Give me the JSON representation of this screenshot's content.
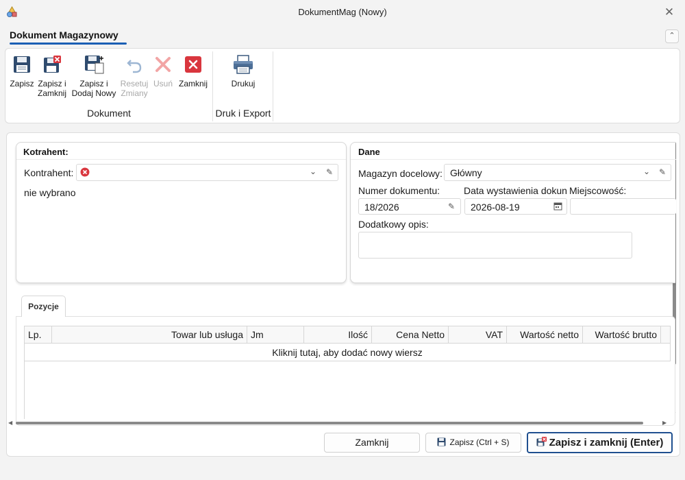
{
  "window": {
    "title": "DokumentMag (Nowy)",
    "close_glyph": "✕",
    "app_icon": "app-shapes-icon"
  },
  "ribbon": {
    "tab_label": "Dokument Magazynowy",
    "collapse_glyph": "⌃",
    "groups": [
      {
        "label": "Dokument",
        "buttons": [
          {
            "line1": "Zapisz",
            "line2": "",
            "icon": "save-icon",
            "enabled": true
          },
          {
            "line1": "Zapisz i",
            "line2": "Zamknij",
            "icon": "save-close-icon",
            "enabled": true
          },
          {
            "line1": "Zapisz i",
            "line2": "Dodaj Nowy",
            "icon": "save-new-icon",
            "enabled": true
          },
          {
            "line1": "Resetuj",
            "line2": "Zmiany",
            "icon": "undo-icon",
            "enabled": false
          },
          {
            "line1": "Usuń",
            "line2": "",
            "icon": "delete-icon",
            "enabled": false
          },
          {
            "line1": "Zamknij",
            "line2": "",
            "icon": "close-icon",
            "enabled": true
          }
        ]
      },
      {
        "label": "Druk i Export",
        "buttons": [
          {
            "line1": "Drukuj",
            "line2": "",
            "icon": "printer-icon",
            "enabled": true
          }
        ]
      }
    ]
  },
  "kontrahent": {
    "title": "Kotrahent:",
    "field_label": "Kontrahent:",
    "status_text": "nie wybrano"
  },
  "dane": {
    "title": "Dane",
    "magazyn_label": "Magazyn docelowy:",
    "magazyn_value": "Główny",
    "numer_label": "Numer dokumentu:",
    "numer_value": "18/2026",
    "data_label": "Data wystawienia dokun",
    "data_value": "2026-08-19",
    "miejscowosc_label": "Miejscowość:",
    "miejscowosc_value": "",
    "opis_label": "Dodatkowy opis:",
    "opis_value": ""
  },
  "pozycje": {
    "tab_label": "Pozycje",
    "columns": [
      "Lp.",
      "Towar lub usługa",
      "Jm",
      "Ilość",
      "Cena Netto",
      "VAT",
      "Wartość netto",
      "Wartość brutto"
    ],
    "add_row_text": "Kliknij tutaj, aby dodać nowy wiersz"
  },
  "footer": {
    "close_label": "Zamknij",
    "save_label": "Zapisz (Ctrl + S)",
    "save_close_label": "Zapisz i zamknij (Enter)"
  },
  "colors": {
    "accent": "#1a5fb4",
    "error_red": "#d9363e",
    "primary_border": "#1f4f8f"
  }
}
